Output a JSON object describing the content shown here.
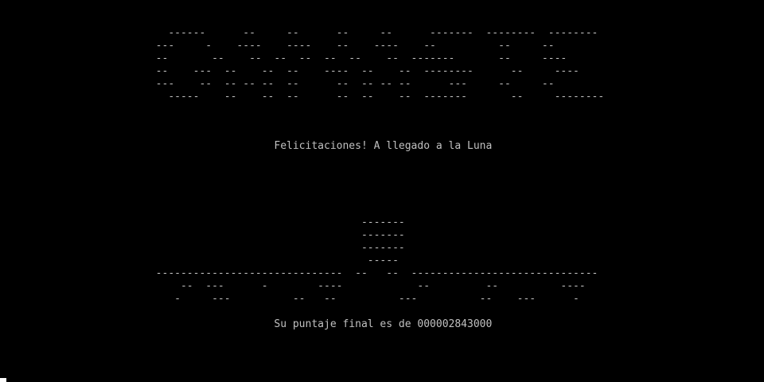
{
  "title_banner": "                           ------      --     --      --     --      -------  --------  --------\n                         ---     -    ----    ----    --    ----    --          --     --\n                         --       --    --  --  --  --  --    --  -------       --     ----\n                         --    ---  --    --  --    ----  --    --  --------      --     ----\n                         ---    --  -- -- --  --      --  -- -- --      ---     --     --\n                           -----    --    --  --      --  --    --  -------       --     --------",
  "message": "                                            Felicitaciones! A llegado a la Luna",
  "lunar_scene": "                                                          -------\n                                                          -------\n                                                          -------\n                                                           -----\n                         ------------------------------  --   --  ------------------------------\n                             --  ---      -        ----            --         --          ----\n                            -     ---          --   --          ---          --    ---      -",
  "score_text": "                                            Su puntaje final es de 000002843000"
}
